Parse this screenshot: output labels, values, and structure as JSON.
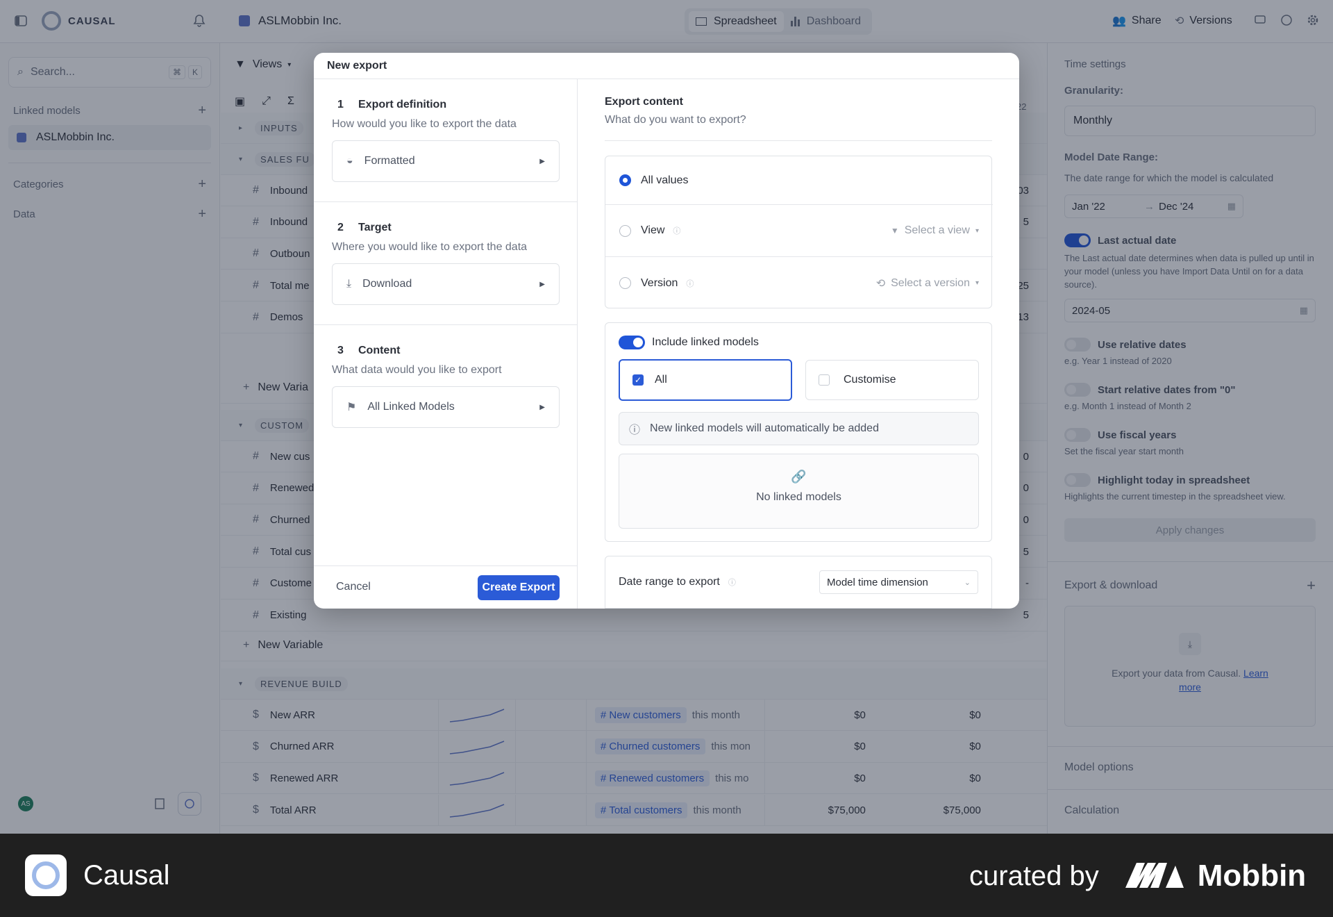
{
  "topbar": {
    "brand": "CAUSAL",
    "model_name": "ASLMobbin Inc.",
    "tabs": [
      {
        "label": "Spreadsheet"
      },
      {
        "label": "Dashboard"
      }
    ],
    "share": "Share",
    "versions": "Versions"
  },
  "sidebar": {
    "search_placeholder": "Search...",
    "shortcut_cmd": "⌘",
    "shortcut_key": "K",
    "linked_models_label": "Linked models",
    "linked_model_item": "ASLMobbin Inc.",
    "categories_label": "Categories",
    "data_label": "Data",
    "avatar": "AS"
  },
  "sheet": {
    "views_label": "Views",
    "header_right": "22",
    "groups": {
      "inputs": "INPUTS",
      "sales": "SALES FU",
      "customers": "CUSTOM",
      "revenue": "REVENUE BUILD"
    },
    "sales_rows": [
      {
        "name": "Inbound",
        "value": "03"
      },
      {
        "name": "Inbound",
        "value": "5"
      },
      {
        "name": "Outboun",
        "value": ""
      },
      {
        "name": "Total me",
        "value": "25"
      },
      {
        "name": "Demos",
        "value": "13"
      }
    ],
    "customer_rows": [
      {
        "name": "New cus",
        "value": "0"
      },
      {
        "name": "Renewed",
        "value": "0"
      },
      {
        "name": "Churned",
        "value": "0"
      },
      {
        "name": "Total cus",
        "value": "5"
      },
      {
        "name": "Custome",
        "value": "-"
      },
      {
        "name": "Existing",
        "value": "5"
      }
    ],
    "new_variable": "New Variable",
    "new_variable_short": "New Varia",
    "revenue_rows": [
      {
        "name": "New ARR",
        "ref": "New customers",
        "suffix": "this month",
        "v1": "$0",
        "v2": "$0"
      },
      {
        "name": "Churned ARR",
        "ref": "Churned customers",
        "suffix": "this mon",
        "v1": "$0",
        "v2": "$0"
      },
      {
        "name": "Renewed ARR",
        "ref": "Renewed customers",
        "suffix": "this mo",
        "v1": "$0",
        "v2": "$0"
      },
      {
        "name": "Total ARR",
        "ref": "Total customers",
        "suffix": "this month",
        "v1": "$75,000",
        "v2": "$75,000"
      }
    ]
  },
  "right_panel": {
    "time_settings": "Time settings",
    "granularity_label": "Granularity:",
    "granularity_value": "Monthly",
    "date_range_label": "Model Date Range:",
    "date_range_desc": "The date range for which the model is calculated",
    "date_start": "Jan '22",
    "date_end": "Dec '24",
    "last_actual_label": "Last actual date",
    "last_actual_desc": "The Last actual date determines when data is pulled up until in your model (unless you have Import Data Until on for a data source).",
    "last_actual_value": "2024-05",
    "relative_dates": "Use relative dates",
    "relative_dates_desc": "e.g. Year 1 instead of 2020",
    "start_relative": "Start relative dates from \"0\"",
    "start_relative_desc": "e.g. Month 1 instead of Month 2",
    "fiscal": "Use fiscal years",
    "fiscal_desc": "Set the fiscal year start month",
    "highlight": "Highlight today in spreadsheet",
    "highlight_desc": "Highlights the current timestep in the spreadsheet view.",
    "apply": "Apply changes",
    "export_download": "Export & download",
    "export_desc": "Export your data from Causal.",
    "learn": "Learn",
    "more": "more",
    "model_options": "Model options",
    "calculation": "Calculation"
  },
  "modal": {
    "title": "New export",
    "steps": [
      {
        "num": "1",
        "title": "Export definition",
        "desc": "How would you like to export the data",
        "choice": "Formatted"
      },
      {
        "num": "2",
        "title": "Target",
        "desc": "Where you would like to export the data",
        "choice": "Download"
      },
      {
        "num": "3",
        "title": "Content",
        "desc": "What data would you like to export",
        "choice": "All Linked Models"
      }
    ],
    "cancel": "Cancel",
    "create": "Create Export",
    "content_title": "Export content",
    "content_desc": "What do you want to export?",
    "opt_all": "All values",
    "opt_view": "View",
    "opt_view_select": "Select a view",
    "opt_version": "Version",
    "opt_version_select": "Select a version",
    "include_linked": "Include linked models",
    "linked_all": "All",
    "linked_customise": "Customise",
    "linked_notice": "New linked models will automatically be added",
    "no_linked": "No linked models",
    "date_range_label": "Date range to export",
    "date_range_value": "Model time dimension"
  },
  "footer": {
    "app_name": "Causal",
    "curated_by": "curated by",
    "mobbin": "Mobbin"
  },
  "colors": {
    "accent": "#1f55d8",
    "footer_bg": "#202020"
  }
}
